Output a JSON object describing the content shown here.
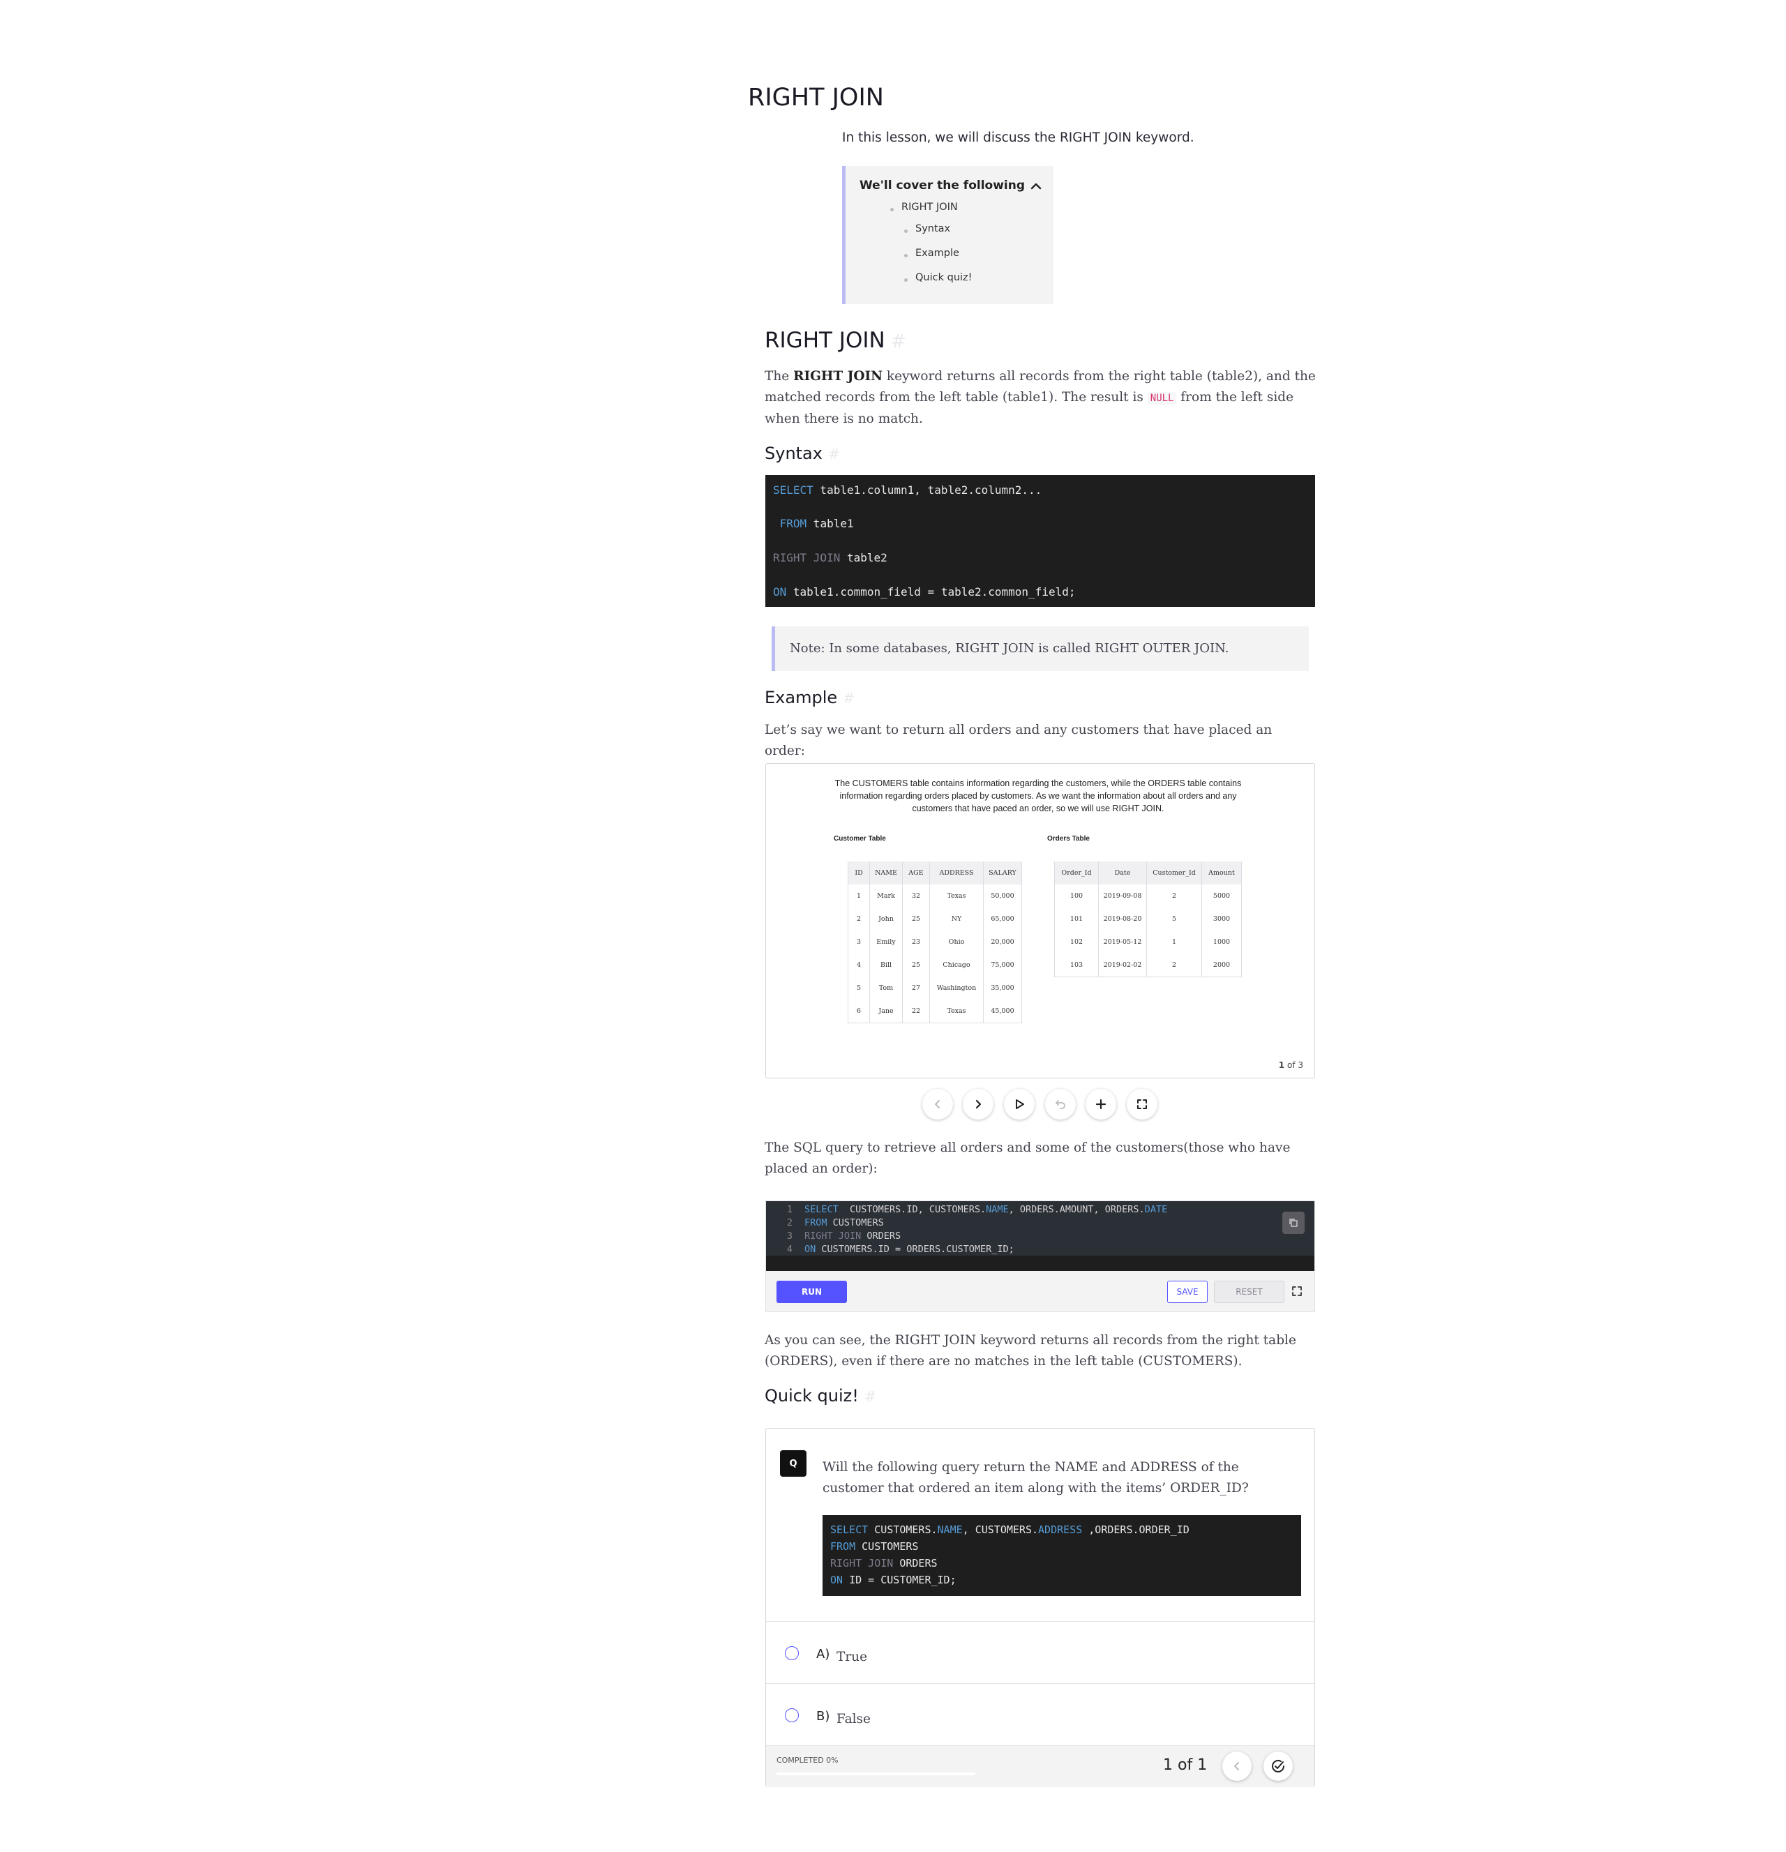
{
  "page_title": "RIGHT JOIN",
  "intro": "In this lesson, we will discuss the RIGHT JOIN keyword.",
  "toc": {
    "title": "We'll cover the following",
    "items": [
      "RIGHT JOIN",
      "Syntax",
      "Example",
      "Quick quiz!"
    ],
    "toggle_icon": "chevron-up-icon"
  },
  "section_right_join": {
    "heading": "RIGHT JOIN",
    "anchor": "#",
    "para_prefix": "The ",
    "para_bold": "RIGHT JOIN",
    "para_mid": " keyword returns all records from the right table (table2), and the matched records from the left table (table1). The result is ",
    "para_code": "NULL",
    "para_suffix": " from the left side when there is no match."
  },
  "syntax": {
    "heading": "Syntax",
    "anchor": "#",
    "lines": [
      {
        "kw": "SELECT",
        "rest": " table1.column1, table2.column2..."
      },
      {
        "kw": " FROM",
        "rest": " table1"
      },
      {
        "kw": "RIGHT JOIN",
        "rest": " table2"
      },
      {
        "kw": "ON",
        "rest": " table1.common_field = table2.common_field;"
      }
    ],
    "note": "Note: In some databases, RIGHT JOIN is called RIGHT OUTER JOIN."
  },
  "example": {
    "heading": "Example",
    "anchor": "#",
    "text": "Let’s say we want to return all orders and any customers that have placed an order:",
    "slide": {
      "description": "The CUSTOMERS table contains information regarding the customers, while the ORDERS table contains information regarding orders placed by customers. As we want the information about all orders and any customers that have paced an order, so we will use RIGHT JOIN.",
      "customer_title": "Customer Table",
      "customer_headers": [
        "ID",
        "NAME",
        "AGE",
        "ADDRESS",
        "SALARY"
      ],
      "customer_rows": [
        [
          "1",
          "Mark",
          "32",
          "Texas",
          "50,000"
        ],
        [
          "2",
          "John",
          "25",
          "NY",
          "65,000"
        ],
        [
          "3",
          "Emily",
          "23",
          "Ohio",
          "20,000"
        ],
        [
          "4",
          "Bill",
          "25",
          "Chicago",
          "75,000"
        ],
        [
          "5",
          "Tom",
          "27",
          "Washington",
          "35,000"
        ],
        [
          "6",
          "Jane",
          "22",
          "Texas",
          "45,000"
        ]
      ],
      "orders_title": "Orders Table",
      "orders_headers": [
        "Order_Id",
        "Date",
        "Customer_Id",
        "Amount"
      ],
      "orders_rows": [
        [
          "100",
          "2019-09-08",
          "2",
          "5000"
        ],
        [
          "101",
          "2019-08-20",
          "5",
          "3000"
        ],
        [
          "102",
          "2019-05-12",
          "1",
          "1000"
        ],
        [
          "103",
          "2019-02-02",
          "2",
          "2000"
        ]
      ],
      "page_current": "1",
      "page_total": "of 3"
    },
    "controls": [
      "chevron-left-icon",
      "chevron-right-icon",
      "play-icon",
      "undo-icon",
      "plus-icon",
      "fullscreen-icon"
    ]
  },
  "query_intro": "The SQL query to retrieve all orders and some of the customers(those who have placed an order):",
  "editor": {
    "lines": [
      {
        "num": "1",
        "parts": [
          {
            "t": "SELECT",
            "c": "kw"
          },
          {
            "t": "  CUSTOMERS.ID, CUSTOMERS.",
            "c": ""
          },
          {
            "t": "NAME",
            "c": "kw"
          },
          {
            "t": ", ORDERS.AMOUNT, ORDERS.",
            "c": ""
          },
          {
            "t": "DATE",
            "c": "kw"
          }
        ]
      },
      {
        "num": "2",
        "parts": [
          {
            "t": "FROM",
            "c": "kw"
          },
          {
            "t": " CUSTOMERS",
            "c": ""
          }
        ]
      },
      {
        "num": "3",
        "parts": [
          {
            "t": "RIGHT JOIN",
            "c": "kw2"
          },
          {
            "t": " ORDERS",
            "c": ""
          }
        ]
      },
      {
        "num": "4",
        "parts": [
          {
            "t": "ON",
            "c": "kw"
          },
          {
            "t": " CUSTOMERS.ID = ORDERS.CUSTOMER_ID;",
            "c": ""
          }
        ]
      }
    ],
    "run_label": "RUN",
    "save_label": "SAVE",
    "reset_label": "RESET"
  },
  "conclusion": "As you can see, the RIGHT JOIN keyword returns all records from the right table (ORDERS), even if there are no matches in the left table (CUSTOMERS).",
  "quiz": {
    "heading": "Quick quiz!",
    "anchor": "#",
    "badge": "Q",
    "question": "Will the following query return the NAME and ADDRESS of the customer that ordered an item along with the items’ ORDER_ID?",
    "code_lines": [
      [
        {
          "t": "SELECT",
          "c": "kw"
        },
        {
          "t": " CUSTOMERS.",
          "c": ""
        },
        {
          "t": "NAME",
          "c": "kw"
        },
        {
          "t": ", CUSTOMERS.",
          "c": ""
        },
        {
          "t": "ADDRESS",
          "c": "kw"
        },
        {
          "t": " ,ORDERS.ORDER_ID",
          "c": ""
        }
      ],
      [
        {
          "t": "FROM",
          "c": "kw"
        },
        {
          "t": " CUSTOMERS",
          "c": ""
        }
      ],
      [
        {
          "t": "RIGHT JOIN",
          "c": "kw2"
        },
        {
          "t": " ORDERS",
          "c": ""
        }
      ],
      [
        {
          "t": "ON",
          "c": "kw"
        },
        {
          "t": " ID = CUSTOMER_ID;",
          "c": ""
        }
      ]
    ],
    "options": [
      {
        "letter": "A)",
        "text": "True"
      },
      {
        "letter": "B)",
        "text": "False"
      }
    ],
    "completed_label": "COMPLETED 0%",
    "completed_fraction": 0,
    "pager": "1 of 1"
  }
}
